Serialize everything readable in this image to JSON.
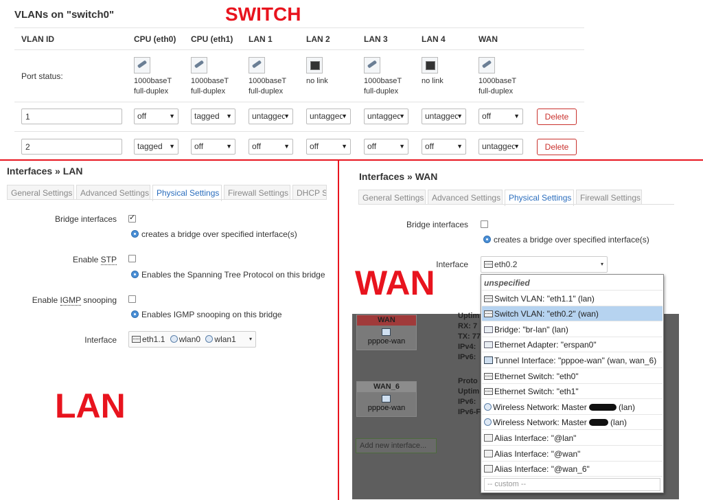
{
  "switch": {
    "title": "VLANs on \"switch0\"",
    "overlay": "SWITCH",
    "columns": [
      "VLAN ID",
      "CPU (eth0)",
      "CPU (eth1)",
      "LAN 1",
      "LAN 2",
      "LAN 3",
      "LAN 4",
      "WAN"
    ],
    "port_status_label": "Port status:",
    "ports": [
      {
        "line1": "1000baseT",
        "line2": "full-duplex",
        "link": true
      },
      {
        "line1": "1000baseT",
        "line2": "full-duplex",
        "link": true
      },
      {
        "line1": "1000baseT",
        "line2": "full-duplex",
        "link": true
      },
      {
        "line1": "no link",
        "line2": "",
        "link": false
      },
      {
        "line1": "1000baseT",
        "line2": "full-duplex",
        "link": true
      },
      {
        "line1": "no link",
        "line2": "",
        "link": false
      },
      {
        "line1": "1000baseT",
        "line2": "full-duplex",
        "link": true
      }
    ],
    "rows": [
      {
        "vlan_id": "1",
        "values": [
          "off",
          "tagged",
          "untagged",
          "untagged",
          "untagged",
          "untagged",
          "off"
        ],
        "delete_label": "Delete"
      },
      {
        "vlan_id": "2",
        "values": [
          "tagged",
          "off",
          "off",
          "off",
          "off",
          "off",
          "untagged"
        ],
        "delete_label": "Delete"
      }
    ]
  },
  "lan": {
    "title": "Interfaces » LAN",
    "overlay": "LAN",
    "tabs": [
      "General Settings",
      "Advanced Settings",
      "Physical Settings",
      "Firewall Settings",
      "DHCP S"
    ],
    "active_tab": 2,
    "bridge_label": "Bridge interfaces",
    "bridge_help": "creates a bridge over specified interface(s)",
    "stp_label_prefix": "Enable ",
    "stp_abbr": "STP",
    "stp_help": "Enables the Spanning Tree Protocol on this bridge",
    "igmp_label_prefix": "Enable ",
    "igmp_abbr": "IGMP",
    "igmp_label_suffix": " snooping",
    "igmp_help": "Enables IGMP snooping on this bridge",
    "interface_label": "Interface",
    "interfaces": [
      "eth1.1",
      "wlan0",
      "wlan1"
    ]
  },
  "wan": {
    "title": "Interfaces » WAN",
    "overlay": "WAN",
    "tabs": [
      "General Settings",
      "Advanced Settings",
      "Physical Settings",
      "Firewall Settings"
    ],
    "active_tab": 2,
    "bridge_label": "Bridge interfaces",
    "bridge_help": "creates a bridge over specified interface(s)",
    "interface_label": "Interface",
    "interface_value": "eth0.2",
    "dropdown": [
      "unspecified",
      "Switch VLAN: \"eth1.1\" (lan)",
      "Switch VLAN: \"eth0.2\" (wan)",
      "Bridge: \"br-lan\" (lan)",
      "Ethernet Adapter: \"erspan0\"",
      "Tunnel Interface: \"pppoe-wan\" (wan, wan_6)",
      "Ethernet Switch: \"eth0\"",
      "Ethernet Switch: \"eth1\"",
      "Wireless Network: Master",
      "Wireless Network: Master",
      "Alias Interface: \"@lan\"",
      "Alias Interface: \"@wan\"",
      "Alias Interface: \"@wan_6\""
    ],
    "wireless_suffix_1": "(lan)",
    "wireless_suffix_2": "(lan)",
    "custom_placeholder": "-- custom --",
    "bg_card1_head": "WAN",
    "bg_card1_foot": "pppoe-wan",
    "bg_card2_head": "WAN_6",
    "bg_card2_foot": "pppoe-wan",
    "bg_lines1": [
      "Uptim",
      "RX: 7",
      "TX: 77",
      "IPv4:",
      "IPv6:"
    ],
    "bg_lines2": [
      "Proto",
      "Uptim",
      "IPv6:",
      "IPv6-F"
    ],
    "bg_add_button": "Add new interface..."
  },
  "colors": {
    "overlay_red": "#e8141e",
    "active_tab": "#2a6dbd",
    "delete": "#c9302c"
  }
}
